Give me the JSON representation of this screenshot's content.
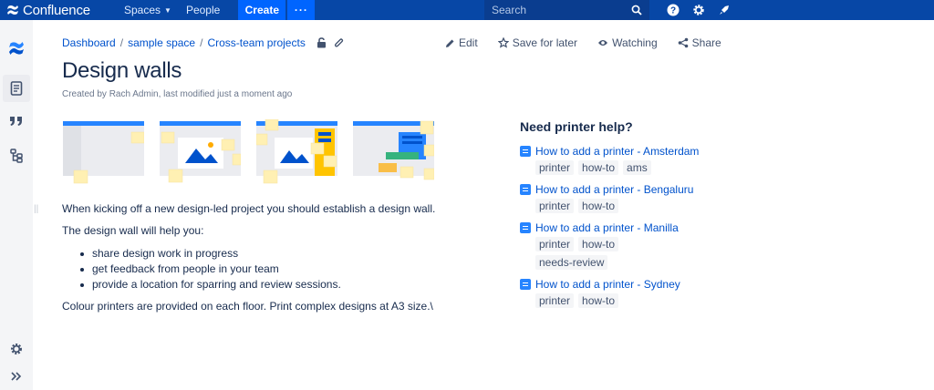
{
  "topnav": {
    "brand": "Confluence",
    "spaces": "Spaces",
    "people": "People",
    "create": "Create",
    "more": "···",
    "search_placeholder": "Search"
  },
  "breadcrumb": [
    "Dashboard",
    "sample space",
    "Cross-team projects"
  ],
  "actions": {
    "edit": "Edit",
    "save": "Save for later",
    "watching": "Watching",
    "share": "Share"
  },
  "page": {
    "title": "Design walls",
    "byline": "Created by Rach Admin, last modified just a moment ago"
  },
  "content": {
    "p1": "When kicking off a new design-led project you should establish a design wall.",
    "p2": "The design wall will help you:",
    "bullets": [
      "share design work in progress",
      "get feedback from people in your team",
      "provide a location for sparring and review sessions."
    ],
    "p3": "Colour printers are provided on each floor. Print complex designs at A3 size.\\"
  },
  "right_panel": {
    "title": "Need printer help?",
    "items": [
      {
        "link": "How to add a printer - Amsterdam",
        "labels": [
          "printer",
          "how-to",
          "ams"
        ]
      },
      {
        "link": "How to add a printer - Bengaluru",
        "labels": [
          "printer",
          "how-to"
        ]
      },
      {
        "link": "How to add a printer - Manilla",
        "labels": [
          "printer",
          "how-to",
          "needs-review"
        ]
      },
      {
        "link": "How to add a printer - Sydney",
        "labels": [
          "printer",
          "how-to"
        ]
      }
    ]
  },
  "colors": {
    "nav_bg": "#0747a6",
    "create_bg": "#0065ff",
    "link": "#0052cc",
    "sidebar_bg": "#f4f5f7",
    "sticky_note": "#fff0b3"
  },
  "icons": {
    "topnav": [
      "help-icon",
      "settings-icon",
      "notifications-icon"
    ],
    "sidebar": [
      "confluence-logo-icon",
      "pages-icon",
      "quote-icon",
      "hierarchy-icon",
      "settings-icon",
      "expand-icon"
    ]
  }
}
